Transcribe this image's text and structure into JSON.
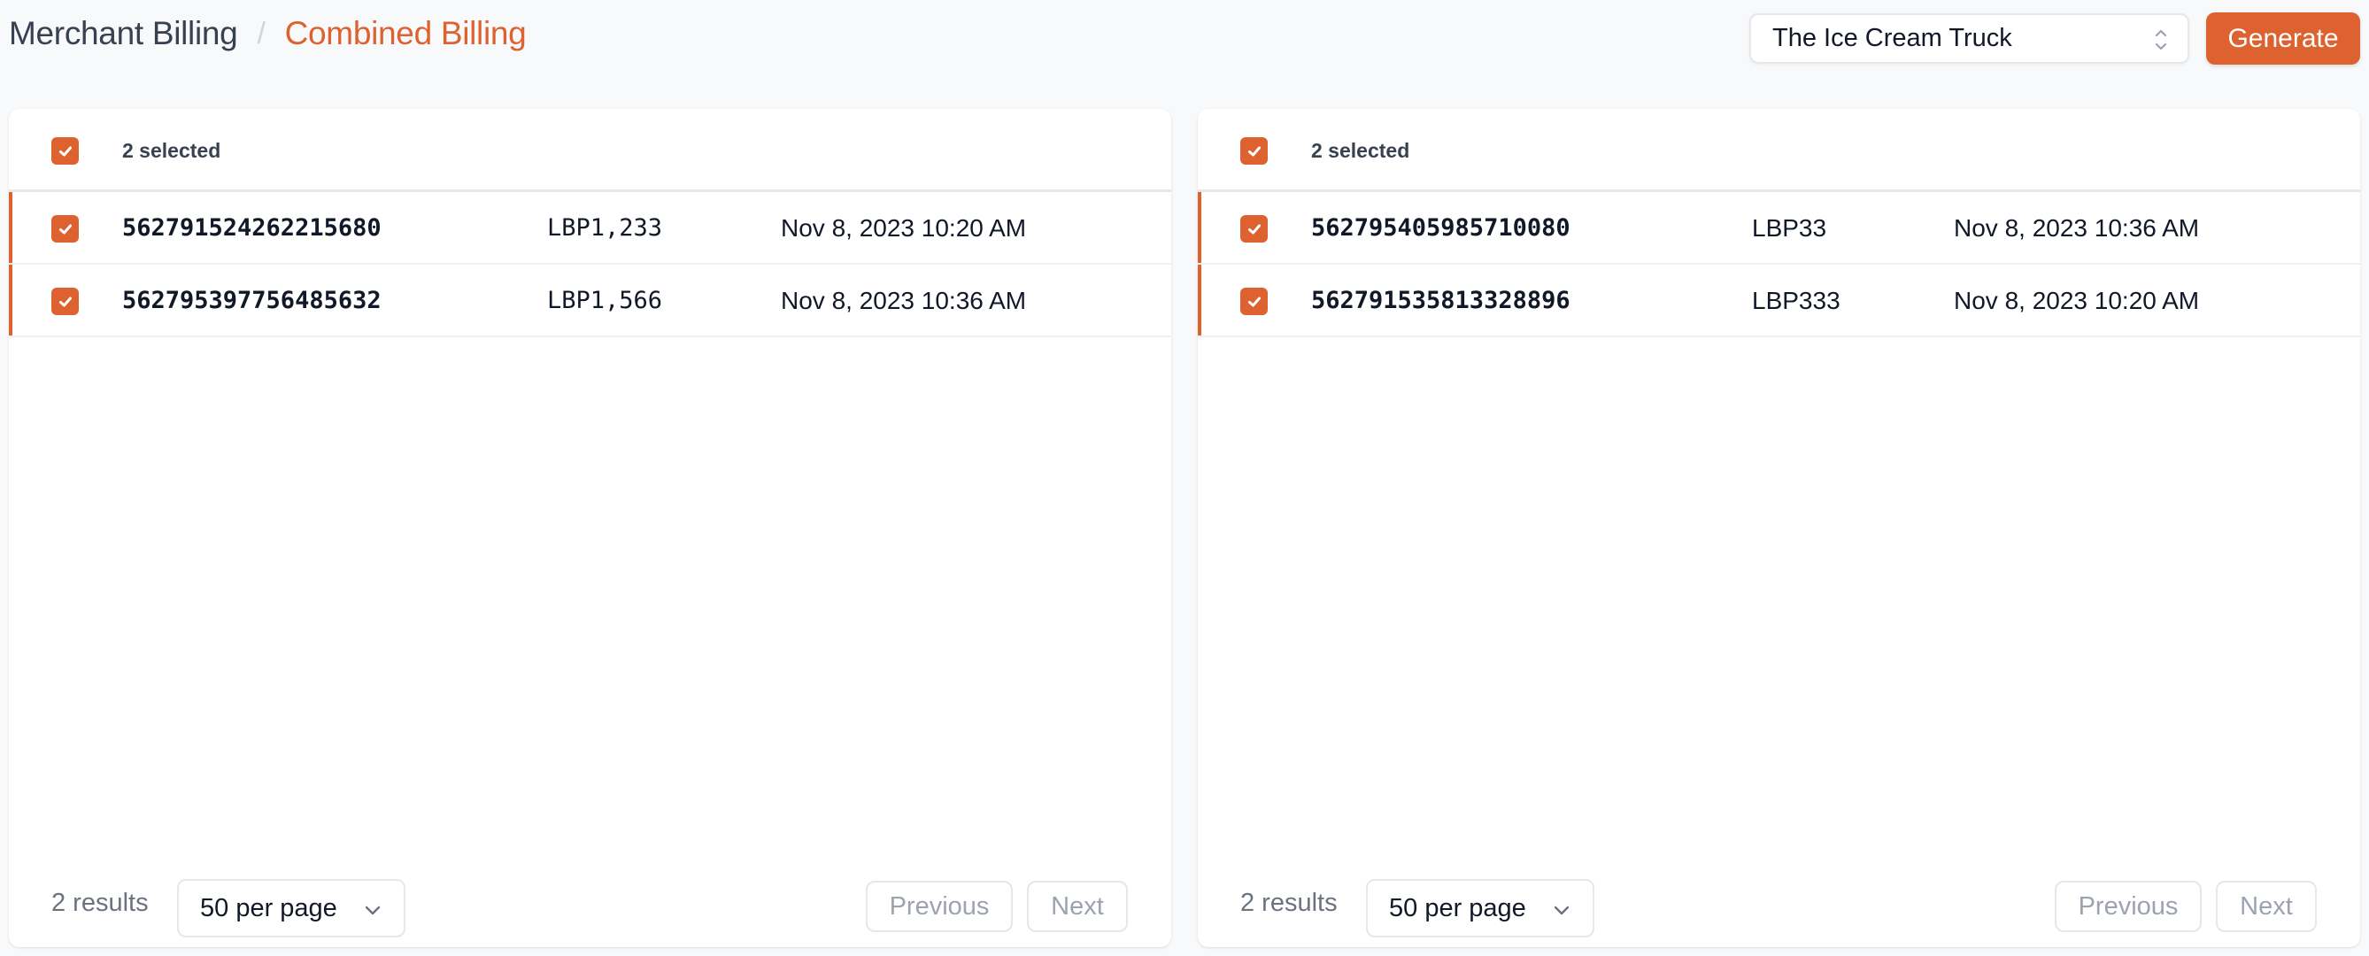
{
  "breadcrumb": {
    "parent": "Merchant Billing",
    "separator": "/",
    "current": "Combined Billing"
  },
  "toolbar": {
    "merchant_select_value": "The Ice Cream Truck",
    "generate_label": "Generate"
  },
  "colors": {
    "accent": "#dd6230",
    "text_primary": "#111827",
    "text_muted": "#6b7280",
    "border": "#e5e7eb",
    "background": "#f8f9fb"
  },
  "panels": [
    {
      "selected_label": "2 selected",
      "rows": [
        {
          "id": "562791524262215680",
          "amount": "LBP1,233",
          "date": "Nov 8, 2023 10:20 AM",
          "checked": true
        },
        {
          "id": "562795397756485632",
          "amount": "LBP1,566",
          "date": "Nov 8, 2023 10:36 AM",
          "checked": true
        }
      ],
      "footer": {
        "results": "2 results",
        "per_page": "50 per page",
        "previous": "Previous",
        "next": "Next"
      }
    },
    {
      "selected_label": "2 selected",
      "rows": [
        {
          "id": "562795405985710080",
          "amount": "LBP33",
          "date": "Nov 8, 2023 10:36 AM",
          "checked": true
        },
        {
          "id": "562791535813328896",
          "amount": "LBP333",
          "date": "Nov 8, 2023 10:20 AM",
          "checked": true
        }
      ],
      "footer": {
        "results": "2 results",
        "per_page": "50 per page",
        "previous": "Previous",
        "next": "Next"
      }
    }
  ]
}
